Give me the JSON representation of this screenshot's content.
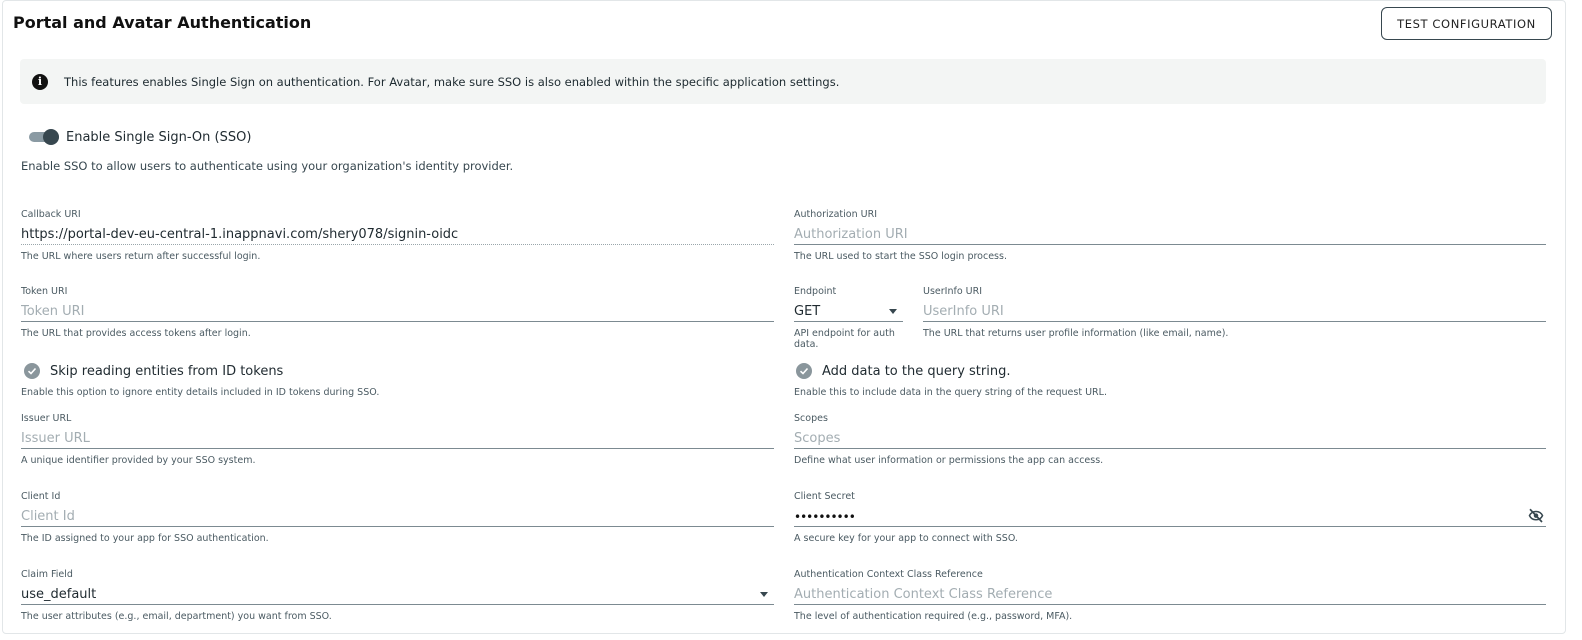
{
  "header": {
    "title": "Portal and Avatar Authentication",
    "test_button": "TEST CONFIGURATION"
  },
  "info": {
    "icon": "info-icon",
    "text": "This features enables Single Sign on authentication. For Avatar, make sure SSO is also enabled within the specific application settings."
  },
  "sso": {
    "enabled": true,
    "label": "Enable Single Sign-On (SSO)",
    "description": "Enable SSO to allow users to authenticate using your organization's identity provider."
  },
  "fields": {
    "callback_uri": {
      "label": "Callback URI",
      "value": "https://portal-dev-eu-central-1.inappnavi.com/shery078/signin-oidc",
      "help": "The URL where users return after successful login."
    },
    "authorization_uri": {
      "label": "Authorization URI",
      "placeholder": "Authorization URI",
      "help": "The URL used to start the SSO login process."
    },
    "token_uri": {
      "label": "Token URI",
      "placeholder": "Token URI",
      "help": "The URL that provides access tokens after login."
    },
    "endpoint": {
      "label": "Endpoint",
      "value": "GET",
      "help": "API endpoint for auth data."
    },
    "userinfo_uri": {
      "label": "UserInfo URI",
      "placeholder": "UserInfo URI",
      "help": "The URL that returns user profile information (like email, name)."
    },
    "issuer_url": {
      "label": "Issuer URL",
      "placeholder": "Issuer URL",
      "help": "A unique identifier provided by your SSO system."
    },
    "scopes": {
      "label": "Scopes",
      "placeholder": "Scopes",
      "help": "Define what user information or permissions the app can access."
    },
    "client_id": {
      "label": "Client Id",
      "placeholder": "Client Id",
      "help": "The ID assigned to your app for SSO authentication."
    },
    "client_secret": {
      "label": "Client Secret",
      "value": "••••••••••",
      "help": "A secure key for your app to connect with SSO."
    },
    "claim_field": {
      "label": "Claim Field",
      "value": "use_default",
      "help": "The user attributes (e.g., email, department) you want from SSO."
    },
    "acr": {
      "label": "Authentication Context Class Reference",
      "placeholder": "Authentication Context Class Reference",
      "help": "The level of authentication required (e.g., password, MFA)."
    }
  },
  "checks": {
    "skip_id_tokens": {
      "checked": true,
      "label": "Skip reading entities from ID tokens",
      "description": "Enable this option to ignore entity details included in ID tokens during SSO."
    },
    "query_string": {
      "checked": true,
      "label": "Add data to the query string.",
      "description": "Enable this to include data in the query string of the request URL."
    }
  },
  "colors": {
    "accent": "#37474f",
    "banner_bg": "#f3f5f4",
    "check": "#8a969c"
  }
}
